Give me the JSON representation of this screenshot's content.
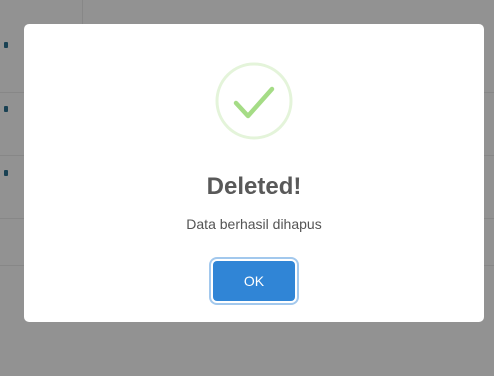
{
  "dialog": {
    "icon": "success-check-icon",
    "title": "Deleted!",
    "message": "Data berhasil dihapus",
    "confirm_label": "OK"
  },
  "colors": {
    "success": "#a5dc86",
    "confirm_button": "#3085d6",
    "overlay": "rgba(0,0,0,0.4)"
  }
}
